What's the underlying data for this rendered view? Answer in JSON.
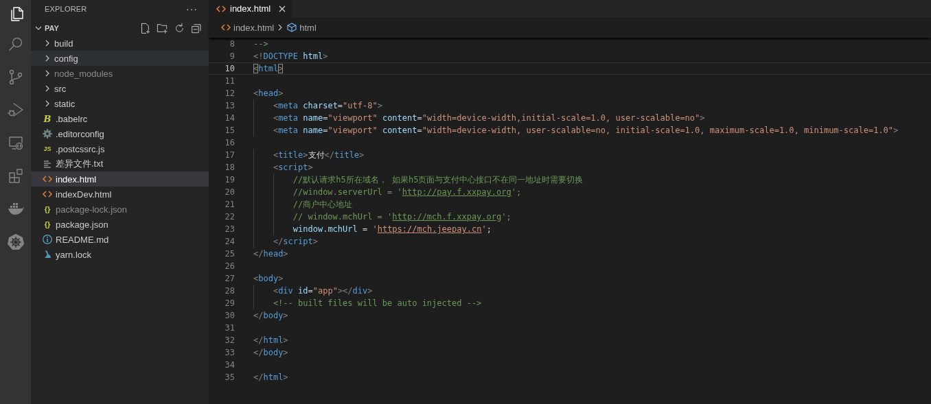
{
  "activity_bar": [
    {
      "kind": "files",
      "selected": true
    },
    {
      "kind": "search",
      "selected": false
    },
    {
      "kind": "source-control",
      "selected": false
    },
    {
      "kind": "debug",
      "selected": false
    },
    {
      "kind": "remote",
      "selected": false
    },
    {
      "kind": "extensions",
      "selected": false
    },
    {
      "kind": "docker",
      "selected": false
    },
    {
      "kind": "kubernetes",
      "selected": false
    }
  ],
  "sidebar": {
    "title": "EXPLORER",
    "more": "···",
    "root": {
      "label": "PAY",
      "expanded": true,
      "children": [
        {
          "label": "build",
          "kind": "folder",
          "expanded": false,
          "selected": false,
          "hover": false,
          "dimmed": false
        },
        {
          "label": "config",
          "kind": "folder",
          "expanded": false,
          "selected": false,
          "hover": true,
          "dimmed": false
        },
        {
          "label": "node_modules",
          "kind": "folder",
          "expanded": false,
          "selected": false,
          "hover": false,
          "dimmed": true
        },
        {
          "label": "src",
          "kind": "folder",
          "expanded": false,
          "selected": false,
          "hover": false,
          "dimmed": false
        },
        {
          "label": "static",
          "kind": "folder",
          "expanded": false,
          "selected": false,
          "hover": false,
          "dimmed": false
        },
        {
          "label": ".babelrc",
          "kind": "babel",
          "glyph": "B",
          "selected": false,
          "hover": false,
          "dimmed": false
        },
        {
          "label": ".editorconfig",
          "kind": "gear",
          "selected": false,
          "hover": false,
          "dimmed": false
        },
        {
          "label": ".postcssrc.js",
          "kind": "js",
          "glyph": "JS",
          "selected": false,
          "hover": false,
          "dimmed": false
        },
        {
          "label": "差异文件.txt",
          "kind": "text",
          "selected": false,
          "hover": false,
          "dimmed": false
        },
        {
          "label": "index.html",
          "kind": "html",
          "selected": true,
          "hover": false,
          "dimmed": false
        },
        {
          "label": "indexDev.html",
          "kind": "html",
          "selected": false,
          "hover": false,
          "dimmed": false
        },
        {
          "label": "package-lock.json",
          "kind": "json",
          "glyph": "{}",
          "selected": false,
          "hover": false,
          "dimmed": true
        },
        {
          "label": "package.json",
          "kind": "json",
          "glyph": "{}",
          "selected": false,
          "hover": false,
          "dimmed": false
        },
        {
          "label": "README.md",
          "kind": "info",
          "selected": false,
          "hover": false,
          "dimmed": false
        },
        {
          "label": "yarn.lock",
          "kind": "yarn",
          "selected": false,
          "hover": false,
          "dimmed": false
        }
      ]
    }
  },
  "tabs": [
    {
      "label": "index.html",
      "selected": true
    }
  ],
  "breadcrumbs": [
    {
      "label": "index.html",
      "kind": "html"
    },
    {
      "label": "html",
      "kind": "element"
    }
  ],
  "editor": {
    "lines": [
      {
        "number": "8",
        "current": false,
        "text": "-->"
      },
      {
        "number": "9",
        "current": false,
        "text": "<!DOCTYPE html>"
      },
      {
        "number": "10",
        "current": true,
        "bracket_match": true,
        "text": "<html>"
      },
      {
        "number": "11",
        "current": false
      },
      {
        "number": "12",
        "current": false,
        "text": "<head>"
      },
      {
        "number": "13",
        "current": false,
        "text": "    <meta charset=\"utf-8\">"
      },
      {
        "number": "14",
        "current": false,
        "text": "    <meta name=\"viewport\" content=\"width=device-width,initial-scale=1.0, user-scalable=no\">"
      },
      {
        "number": "15",
        "current": false,
        "text": "    <meta name=\"viewport\" content=\"width=device-width, user-scalable=no, initial-scale=1.0, maximum-scale=1.0, minimum-scale=1.0\">"
      },
      {
        "number": "16",
        "current": false
      },
      {
        "number": "17",
        "current": false,
        "text": "    <title>支付</title>"
      },
      {
        "number": "18",
        "current": false,
        "text": "    <script>"
      },
      {
        "number": "19",
        "current": false,
        "text": "        //默认请求h5所在域名， 如果h5页面与支付中心接口不在同一地址时需要切换"
      },
      {
        "number": "20",
        "current": false,
        "text": "        //window.serverUrl = 'http://pay.f.xxpay.org';"
      },
      {
        "number": "21",
        "current": false,
        "text": "        //商户中心地址"
      },
      {
        "number": "22",
        "current": false,
        "text": "        // window.mchUrl = 'http://mch.f.xxpay.org';"
      },
      {
        "number": "23",
        "current": false,
        "text": "        window.mchUrl = 'https://mch.jeepay.cn';"
      },
      {
        "number": "24",
        "current": false,
        "text": "    </script>"
      },
      {
        "number": "25",
        "current": false,
        "text": "</head>"
      },
      {
        "number": "26",
        "current": false
      },
      {
        "number": "27",
        "current": false,
        "text": "<body>"
      },
      {
        "number": "28",
        "current": false,
        "text": "    <div id=\"app\"></div>"
      },
      {
        "number": "29",
        "current": false,
        "text": "    <!-- built files will be auto injected -->"
      },
      {
        "number": "30",
        "current": false,
        "text": "</body>"
      },
      {
        "number": "31",
        "current": false
      },
      {
        "number": "32",
        "current": false,
        "text": "</html>"
      },
      {
        "number": "33",
        "current": false,
        "text": "</body>"
      },
      {
        "number": "34",
        "current": false
      },
      {
        "number": "35",
        "current": false,
        "text": "</html>"
      }
    ]
  }
}
